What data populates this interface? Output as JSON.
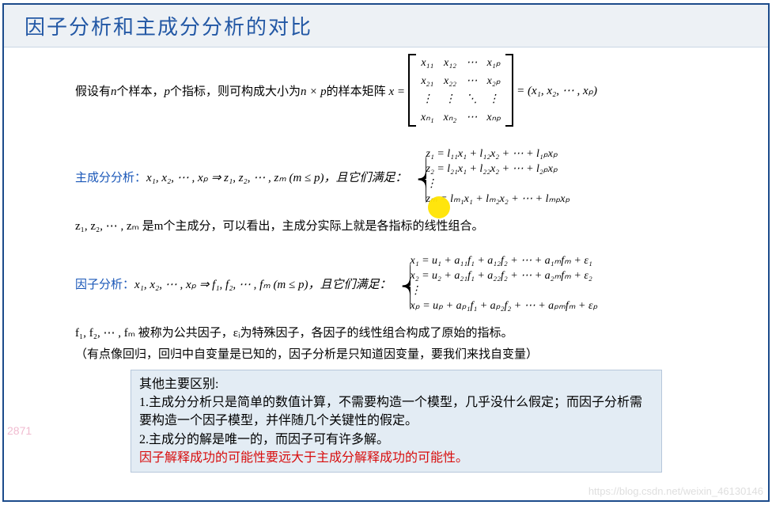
{
  "header": {
    "title": "因子分析和主成分分析的对比"
  },
  "intro": {
    "pre": "假设有",
    "n": "n",
    "mid1": "个样本，",
    "p": "p",
    "mid2": "个指标，则可构成大小为",
    "size": "n × p",
    "mid3": "的样本矩阵 ",
    "xeq": "x =",
    "after_matrix_eq": "= (x₁, x₂, ⋯ , xₚ)"
  },
  "matrix": {
    "r1c1": "x₁₁",
    "r1c2": "x₁₂",
    "r1c3": "⋯",
    "r1c4": "x₁ₚ",
    "r2c1": "x₂₁",
    "r2c2": "x₂₂",
    "r2c3": "⋯",
    "r2c4": "x₂ₚ",
    "r3c1": "⋮",
    "r3c2": "⋮",
    "r3c3": "⋱",
    "r3c4": "⋮",
    "r4c1": "xₙ₁",
    "r4c2": "xₙ₂",
    "r4c3": "⋯",
    "r4c4": "xₙₚ"
  },
  "pca": {
    "label": "主成分分析：",
    "vars": "x₁, x₂, ⋯ , xₚ ⇒ z₁, z₂, ⋯ , zₘ (m ≤ p)，且它们满足：",
    "eq1": "z₁ = l₁₁x₁ + l₁₂x₂ + ⋯ + l₁ₚxₚ",
    "eq2": "z₂ = l₂₁x₁ + l₂₂x₂ + ⋯ + l₂ₚxₚ",
    "eq3": "⋮",
    "eq4": "zₘ = lₘ₁x₁ + lₘ₂x₂ + ⋯ + lₘₚxₚ",
    "after": "z₁, z₂, ⋯ , zₘ 是m个主成分，可以看出，主成分实际上就是各指标的线性组合。"
  },
  "fa": {
    "label": "因子分析：",
    "vars": "x₁, x₂, ⋯ , xₚ ⇒ f₁, f₂, ⋯ , fₘ (m ≤ p)，且它们满足：",
    "eq1": "x₁ = u₁ + a₁₁f₁ + a₁₂f₂ + ⋯ + a₁ₘfₘ + ε₁",
    "eq2": "x₂ = u₂ + a₂₁f₁ + a₂₂f₂ + ⋯ + a₂ₘfₘ + ε₂",
    "eq3": "⋮",
    "eq4": "xₚ = uₚ + aₚ₁f₁ + aₚ₂f₂ + ⋯ + aₚₘfₘ + εₚ",
    "after": "f₁, f₂, ⋯ , fₘ 被称为公共因子，εᵢ为特殊因子，各因子的线性组合构成了原始的指标。"
  },
  "paren_note": "（有点像回归，回归中自变量是已知的，因子分析是只知道因变量，要我们来找自变量）",
  "box": {
    "l0": "其他主要区别:",
    "l1": "1.主成分分析只是简单的数值计算，不需要构造一个模型，几乎没什么假定；而因子分析需要构造一个因子模型，并伴随几个关键性的假定。",
    "l2": "2.主成分的解是唯一的，而因子可有许多解。",
    "l3": "因子解释成功的可能性要远大于主成分解释成功的可能性。"
  },
  "watermark_left": "2871",
  "watermark_right": "https://blog.csdn.net/weixin_46130146"
}
